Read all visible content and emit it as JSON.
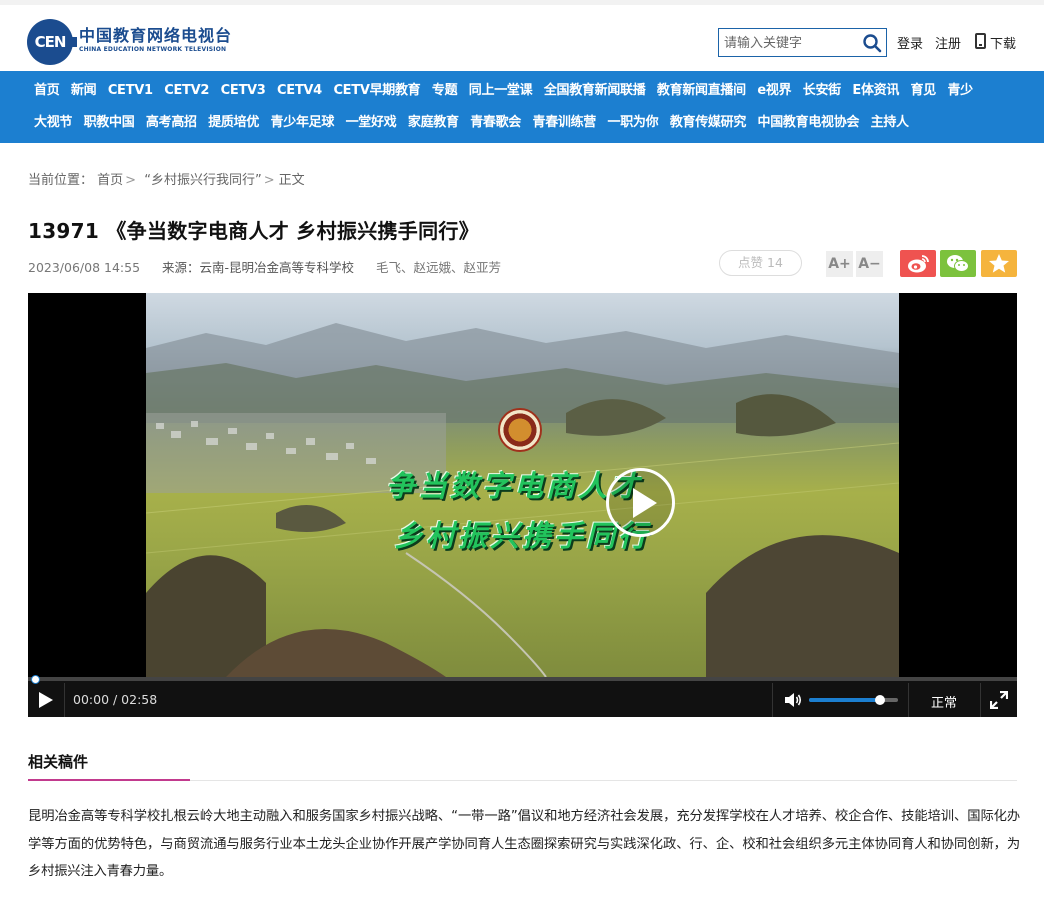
{
  "header": {
    "logo_badge": "CEN",
    "logo_cn": "中国教育网络电视台",
    "logo_en": "CHINA EDUCATION NETWORK TELEVISION",
    "search_placeholder": "请输入关键字",
    "login": "登录",
    "register": "注册",
    "download": "下载"
  },
  "nav": {
    "row1": [
      "首页",
      "新闻",
      "CETV1",
      "CETV2",
      "CETV3",
      "CETV4",
      "CETV早期教育",
      "专题",
      "同上一堂课",
      "全国教育新闻联播",
      "教育新闻直播间",
      "e视界",
      "长安街",
      "E体资讯",
      "育见",
      "青少"
    ],
    "row2": [
      "大视节",
      "职教中国",
      "高考高招",
      "提质培优",
      "青少年足球",
      "一堂好戏",
      "家庭教育",
      "青春歌会",
      "青春训练营",
      "一职为你",
      "教育传媒研究",
      "中国教育电视协会",
      "主持人"
    ]
  },
  "breadcrumb": {
    "prefix": "当前位置：",
    "home": "首页",
    "section": "“乡村振兴行我同行”",
    "current": "正文"
  },
  "article": {
    "title": "13971 《争当数字电商人才 乡村振兴携手同行》",
    "date": "2023/06/08 14:55",
    "source": "来源：云南-昆明冶金高等专科学校",
    "authors": "毛飞、赵远娥、赵亚芳",
    "like_label": "点赞 14",
    "font_increase": "A+",
    "font_decrease": "A−"
  },
  "video": {
    "overlay_line1": "争当数字电商人才",
    "overlay_line2": "乡村振兴携手同行",
    "time": "00:00 / 02:58",
    "playback_rate": "正常",
    "progress": 0.0,
    "volume": 0.8
  },
  "related": {
    "title": "相关稿件",
    "body": "昆明冶金高等专科学校扎根云岭大地主动融入和服务国家乡村振兴战略、“一带一路”倡议和地方经济社会发展，充分发挥学校在人才培养、校企合作、技能培训、国际化办学等方面的优势特色，与商贸流通与服务行业本土龙头企业协作开展产学协同育人生态圈探索研究与实践深化政、行、企、校和社会组织多元主体协同育人和协同创新，为乡村振兴注入青春力量。"
  },
  "colors": {
    "nav_bg": "#1c7fd0",
    "brand": "#1b4c8f",
    "weibo": "#ef5350",
    "wechat": "#7cc23d",
    "favorite": "#f5b43d",
    "accent_line": "#c23a8e"
  }
}
